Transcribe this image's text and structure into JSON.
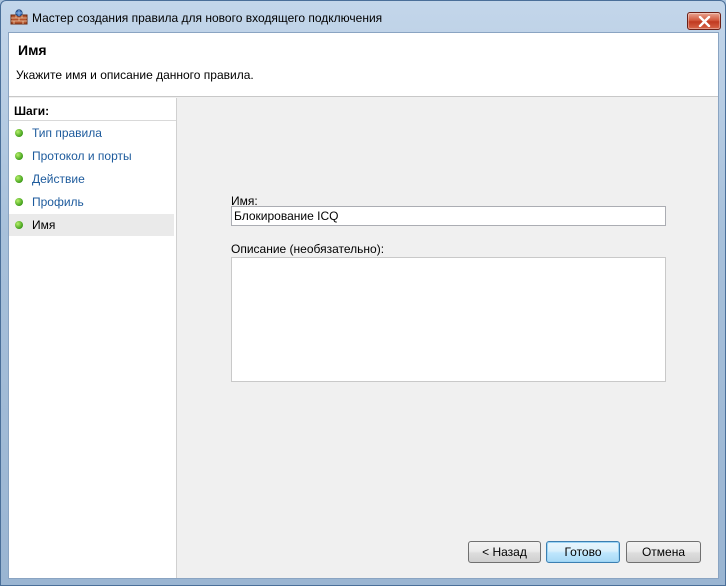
{
  "window": {
    "title": "Мастер создания правила для нового входящего подключения",
    "icon": "firewall-wall-icon",
    "close_icon": "close-icon"
  },
  "header": {
    "title": "Имя",
    "description": "Укажите имя и описание данного правила."
  },
  "steps": {
    "heading": "Шаги:",
    "items": [
      {
        "label": "Тип правила",
        "active": false
      },
      {
        "label": "Протокол и порты",
        "active": false
      },
      {
        "label": "Действие",
        "active": false
      },
      {
        "label": "Профиль",
        "active": false
      },
      {
        "label": "Имя",
        "active": true
      }
    ]
  },
  "form": {
    "name_label": "Имя:",
    "name_value": "Блокирование ICQ",
    "description_label": "Описание (необязательно):",
    "description_value": ""
  },
  "buttons": {
    "back": "< Назад",
    "finish": "Готово",
    "cancel": "Отмена"
  },
  "colors": {
    "step_link": "#1c5a9c",
    "step_bullet": "#3f9e1a",
    "default_button_border": "#3c7fb1"
  }
}
